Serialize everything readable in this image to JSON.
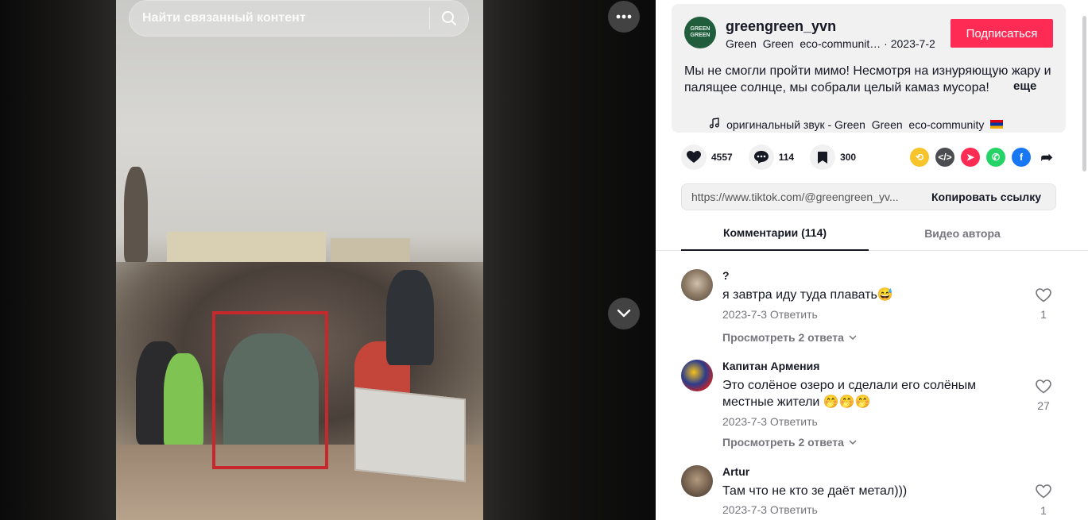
{
  "search": {
    "placeholder": "Найти связанный контент"
  },
  "post": {
    "username": "greengreen_yvn",
    "avatar_text": "GREEN GREEN",
    "subline": "Green  Green  eco-communit… · 2023-7-2",
    "follow_label": "Подписаться",
    "description": "Мы не смогли пройти мимо! Несмотря на изнуряющую жару и палящее солнце, мы собрали целый камаз мусора!",
    "more_label": "еще",
    "sound": "оригинальный звук - Green  Green  eco-community"
  },
  "stats": {
    "likes": "4557",
    "comments": "114",
    "saves": "300"
  },
  "share": {
    "url": "https://www.tiktok.com/@greengreen_yv...",
    "copy_label": "Копировать ссылку"
  },
  "tabs": {
    "comments": "Комментарии (114)",
    "author_videos": "Видео автора"
  },
  "comments": [
    {
      "name": "?",
      "text": "я завтра иду туда плавать😅",
      "meta": "2023-7-3 Ответить",
      "replies": "Просмотреть 2 ответа",
      "likes": "1"
    },
    {
      "name": "Капитан Армения",
      "text": "Это солёное озеро и сделали его солёным местные жители 🤭🤭🤭",
      "meta": "2023-7-3 Ответить",
      "replies": "Просмотреть 2 ответа",
      "likes": "27"
    },
    {
      "name": "Artur",
      "text": "Там что не кто зе даёт метал)))",
      "meta": "2023-7-3 Ответить",
      "likes": "1"
    }
  ],
  "colors": {
    "follow": "#fe2c55",
    "highlight_box": "#c6282b"
  }
}
